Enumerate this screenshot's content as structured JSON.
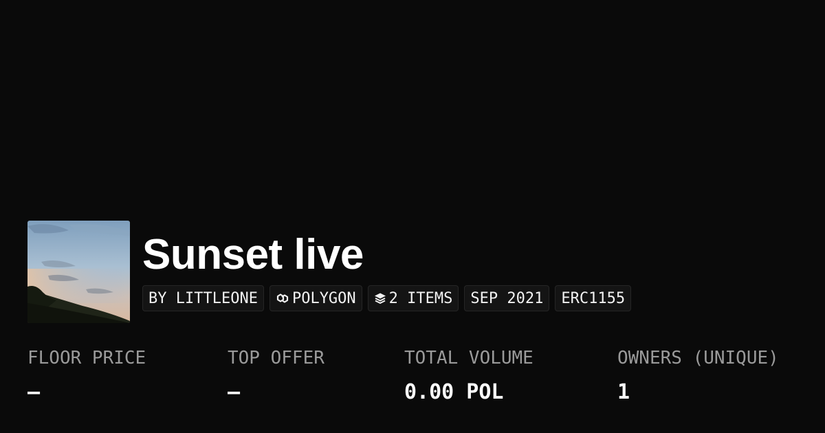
{
  "collection": {
    "title": "Sunset live",
    "image": "sunset-sky-thumbnail"
  },
  "tags": [
    {
      "label": "BY LITTLEONE",
      "icon": ""
    },
    {
      "label": "POLYGON",
      "icon": "polygon-chain-icon"
    },
    {
      "label": "2 ITEMS",
      "icon": "layers-icon"
    },
    {
      "label": "SEP 2021",
      "icon": ""
    },
    {
      "label": "ERC1155",
      "icon": ""
    }
  ],
  "stats": [
    {
      "label": "FLOOR PRICE",
      "value": "–"
    },
    {
      "label": "TOP OFFER",
      "value": "–"
    },
    {
      "label": "TOTAL VOLUME",
      "value": "0.00 POL"
    },
    {
      "label": "OWNERS (UNIQUE)",
      "value": "1"
    }
  ],
  "colors": {
    "background": "#0a0a0a",
    "text": "#ffffff",
    "muted": "#9a9a9a",
    "tag_bg": "#141414",
    "tag_border": "#262626"
  }
}
